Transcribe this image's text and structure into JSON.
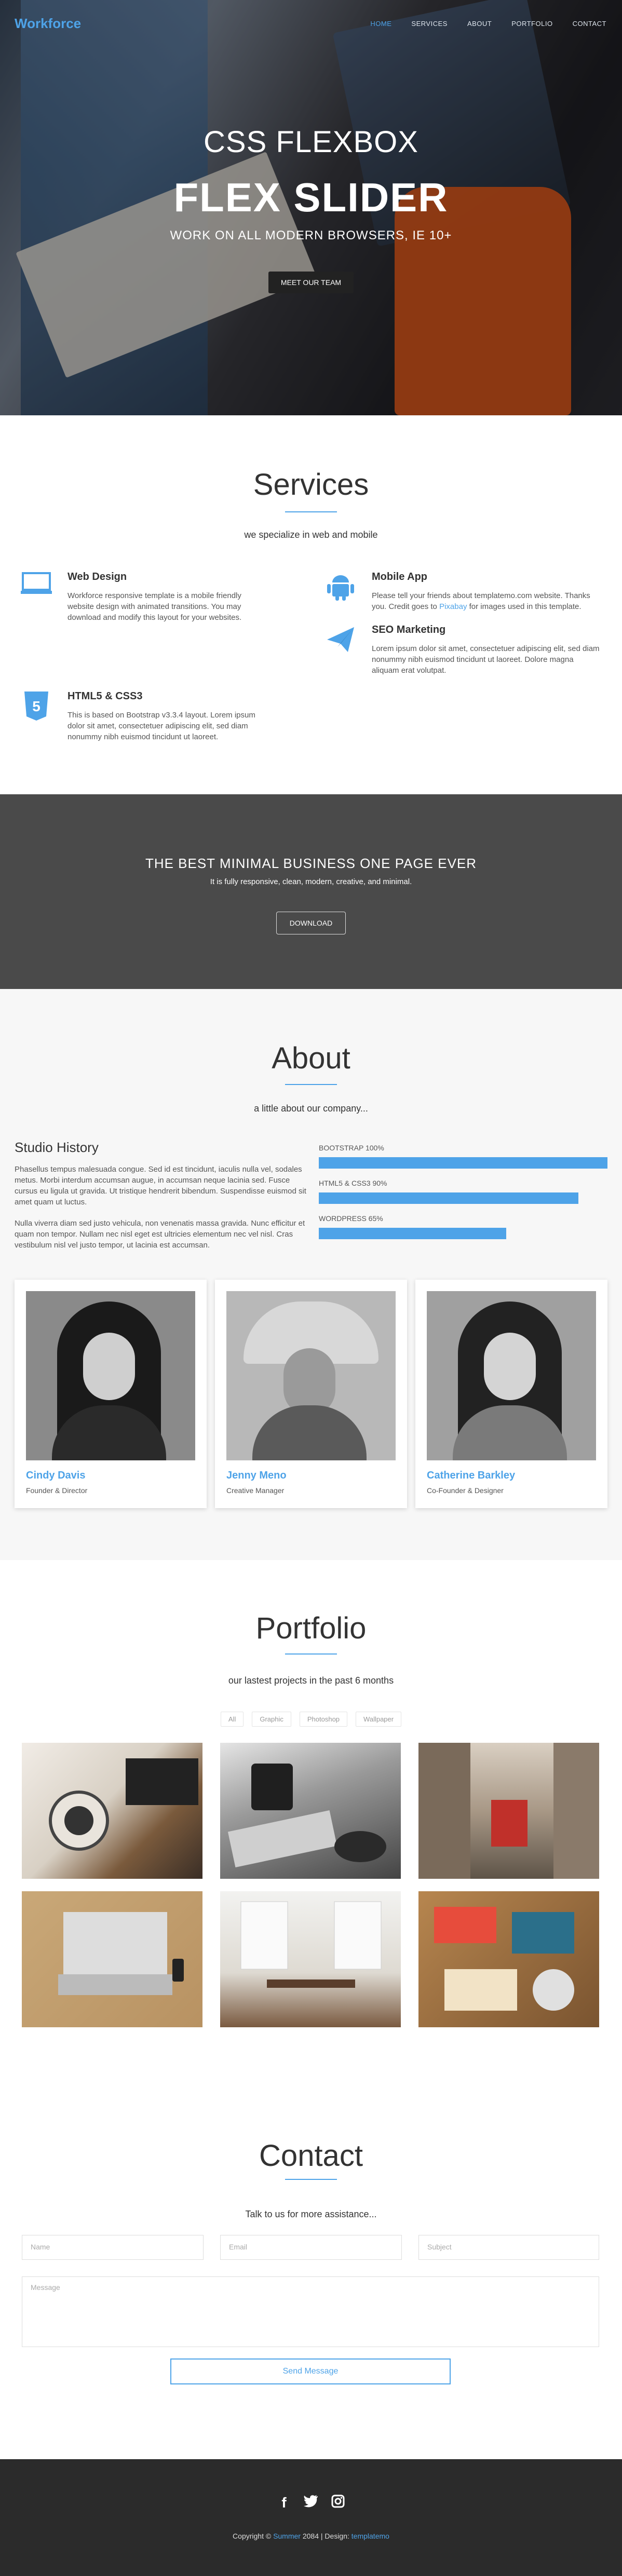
{
  "nav": {
    "brand": "Workforce",
    "items": [
      "HOME",
      "SERVICES",
      "ABOUT",
      "PORTFOLIO",
      "CONTACT"
    ],
    "active_item": "HOME"
  },
  "hero": {
    "line1": "CSS FLEXBOX",
    "line2": "FLEX SLIDER",
    "line3": "WORK ON ALL MODERN BROWSERS, IE 10+",
    "button": "MEET OUR TEAM"
  },
  "services": {
    "title": "Services",
    "subtitle": "we specialize in web and mobile",
    "items": [
      {
        "icon": "monitor-icon",
        "title": "Web Design",
        "text": "Workforce responsive template is a mobile friendly website design with animated transitions. You may download and modify this layout for your websites."
      },
      {
        "icon": "android-icon",
        "title": "Mobile App",
        "text_before": "Please tell your friends about templatemo.com website. Thanks you. Credit goes to ",
        "link": "Pixabay",
        "text_after": " for images used in this template."
      },
      {
        "icon": "paper-plane-icon",
        "title": "SEO Marketing",
        "text": "Lorem ipsum dolor sit amet, consectetuer adipiscing elit, sed diam nonummy nibh euismod tincidunt ut laoreet. Dolore magna aliquam erat volutpat."
      },
      {
        "icon": "html5-icon",
        "title": "HTML5 & CSS3",
        "text": "This is based on Bootstrap v3.3.4 layout. Lorem ipsum dolor sit amet, consectetuer adipiscing elit, sed diam nonummy nibh euismod tincidunt ut laoreet."
      }
    ]
  },
  "banner": {
    "title": "THE BEST MINIMAL BUSINESS ONE PAGE EVER",
    "text": "It is fully responsive, clean, modern, creative, and minimal.",
    "button": "DOWNLOAD"
  },
  "about": {
    "title": "About",
    "subtitle": "a little about our company...",
    "story_title": "Studio History",
    "story_p1": "Phasellus tempus malesuada congue. Sed id est tincidunt, iaculis nulla vel, sodales metus. Morbi interdum accumsan augue, in accumsan neque lacinia sed. Fusce cursus eu ligula ut gravida. Ut tristique hendrerit bibendum. Suspendisse euismod sit amet quam ut luctus.",
    "story_p2": "Nulla viverra diam sed justo vehicula, non venenatis massa gravida. Nunc efficitur et quam non tempor. Nullam nec nisl eget est ultricies elementum nec vel nisl. Cras vestibulum nisl vel justo tempor, ut lacinia est accumsan.",
    "skills": [
      {
        "label": "BOOTSTRAP 100%",
        "level": 100
      },
      {
        "label": "HTML5 & CSS3 90%",
        "level": 90
      },
      {
        "label": "WORDPRESS 65%",
        "level": 65
      }
    ],
    "team": [
      {
        "name": "Cindy Davis",
        "role": "Founder & Director"
      },
      {
        "name": "Jenny Meno",
        "role": "Creative Manager"
      },
      {
        "name": "Catherine Barkley",
        "role": "Co-Founder & Designer"
      }
    ]
  },
  "portfolio": {
    "title": "Portfolio",
    "subtitle": "our lastest projects in the past 6 months",
    "filters": [
      "All",
      "Graphic",
      "Photoshop",
      "Wallpaper"
    ]
  },
  "contact": {
    "title": "Contact",
    "subtitle": "Talk to us for more assistance...",
    "name_placeholder": "Name",
    "email_placeholder": "Email",
    "subject_placeholder": "Subject",
    "message_placeholder": "Message",
    "send_button": "Send Message"
  },
  "footer": {
    "social": [
      "facebook-icon",
      "twitter-icon",
      "instagram-icon"
    ],
    "copy_prefix": "Copyright © ",
    "company": "Summer",
    "copy_mid": " 2084 | Design: ",
    "designer": "templatemo"
  },
  "colors": {
    "accent": "#4ea3e8",
    "banner_bg": "#4a4a4a",
    "footer_bg": "#2b2b2b"
  }
}
